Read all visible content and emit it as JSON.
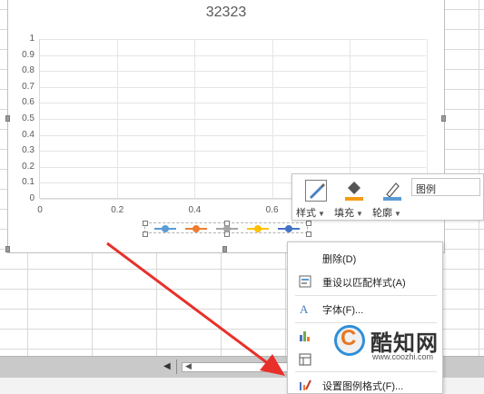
{
  "chart_data": {
    "type": "line",
    "title": "32323",
    "y_ticks": [
      "1",
      "0.9",
      "0.8",
      "0.7",
      "0.6",
      "0.5",
      "0.4",
      "0.3",
      "0.2",
      "0.1",
      "0"
    ],
    "x_ticks": [
      "0",
      "0.2",
      "0.4",
      "0.6"
    ],
    "xlim": [
      0,
      1
    ],
    "ylim": [
      0,
      1
    ],
    "grid": true,
    "legend_position": "bottom",
    "series": [
      {
        "color": "#5b9bd5",
        "values": []
      },
      {
        "color": "#ed7d31",
        "values": []
      },
      {
        "color": "#a5a5a5",
        "values": []
      },
      {
        "color": "#ffc000",
        "values": []
      },
      {
        "color": "#4472c4",
        "values": []
      }
    ]
  },
  "toolbar": {
    "style_label": "样式",
    "fill_label": "填充",
    "outline_label": "轮廓",
    "element_value": "图例",
    "icons": [
      "brush-icon",
      "paint-bucket-icon",
      "pen-icon"
    ]
  },
  "menu": {
    "items": [
      {
        "label": "删除(D)",
        "icon": "none"
      },
      {
        "label": "重设以匹配样式(A)",
        "icon": "reset-style-icon"
      },
      {
        "label": "字体(F)...",
        "icon": "font-icon"
      },
      {
        "label": "",
        "icon": "chart-type-icon"
      },
      {
        "label": "",
        "icon": "select-data-icon"
      },
      {
        "label": "设置图例格式(F)...",
        "icon": "format-legend-icon"
      }
    ]
  },
  "watermark": {
    "title": "酷知网",
    "url": "www.coozhi.com"
  },
  "colors": {
    "accent_blue": "#2f8fd8",
    "arrow_red": "#e8302a"
  }
}
